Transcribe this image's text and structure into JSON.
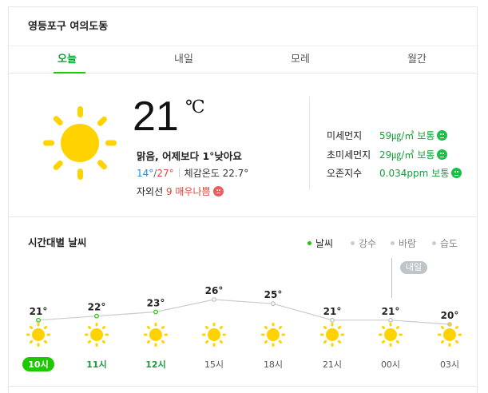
{
  "location": "영등포구 여의도동",
  "tabs": [
    {
      "label": "오늘",
      "active": true
    },
    {
      "label": "내일",
      "active": false
    },
    {
      "label": "모레",
      "active": false
    },
    {
      "label": "월간",
      "active": false
    }
  ],
  "current": {
    "temperature": "21",
    "unit": "℃",
    "summary": "맑음, 어제보다 1°낮아요",
    "low": "14°",
    "slash": "/",
    "high": "27°",
    "feels_like": "체감온도 22.7°",
    "uv_label": "자외선",
    "uv_level": "9 매우나쁨",
    "icon": "sun-icon",
    "colors": {
      "sun": "#ffd200",
      "green": "#1a9b3c",
      "red": "#e0463a",
      "blue": "#2e89d8"
    }
  },
  "air": [
    {
      "label": "미세먼지",
      "value": "59㎍/㎥",
      "grade": "보통"
    },
    {
      "label": "초미세먼지",
      "value": "29㎍/㎥",
      "grade": "보통"
    },
    {
      "label": "오존지수",
      "value": "0.034ppm",
      "grade": "보통"
    }
  ],
  "hourly": {
    "title": "시간대별 날씨",
    "legend": [
      {
        "label": "날씨",
        "active": true
      },
      {
        "label": "강수",
        "active": false
      },
      {
        "label": "바람",
        "active": false
      },
      {
        "label": "습도",
        "active": false
      }
    ],
    "tomorrow_label": "내일"
  },
  "chart_data": {
    "type": "line",
    "categories": [
      "10시",
      "11시",
      "12시",
      "15시",
      "18시",
      "21시",
      "00시",
      "03시"
    ],
    "series": [
      {
        "values": [
          21,
          22,
          23,
          26,
          25,
          21,
          21,
          20
        ]
      }
    ],
    "labels": [
      "21°",
      "22°",
      "23°",
      "26°",
      "25°",
      "21°",
      "21°",
      "20°"
    ],
    "icons": [
      "sun-icon",
      "sun-icon",
      "sun-icon",
      "sun-icon",
      "sun-icon",
      "sun-icon",
      "sun-icon",
      "sun-icon"
    ],
    "current_index": 0,
    "green_indices": [
      1,
      2
    ]
  }
}
